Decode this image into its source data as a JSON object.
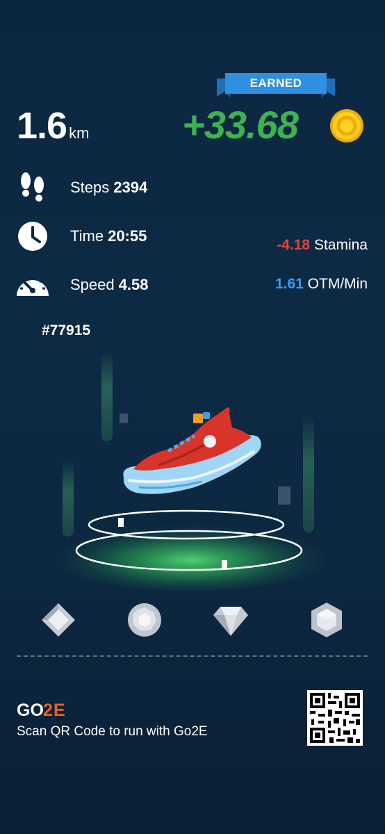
{
  "earned": {
    "badge_label": "EARNED",
    "amount": "+33.68",
    "coin_icon": "coin-icon"
  },
  "distance": {
    "value": "1.6",
    "unit": "km"
  },
  "stats": [
    {
      "icon": "footsteps-icon",
      "label": "Steps",
      "value": "2394"
    },
    {
      "icon": "clock-icon",
      "label": "Time",
      "value": "20:55"
    },
    {
      "icon": "speedometer-icon",
      "label": "Speed",
      "value": "4.58"
    }
  ],
  "stamina": {
    "value": "-4.18",
    "label": "Stamina"
  },
  "rate": {
    "value": "1.61",
    "label": "OTM/Min"
  },
  "shoe": {
    "id": "#77915",
    "image": "sneaker-icon"
  },
  "gem_slots": [
    "diamond-gem-icon",
    "round-gem-icon",
    "crystal-gem-icon",
    "hexagon-gem-icon"
  ],
  "footer": {
    "brand": "GO2E",
    "tagline": "Scan QR Code to run with Go2E",
    "qr_icon": "qr-code-icon"
  },
  "colors": {
    "earned_green": "#3fb24f",
    "stamina_red": "#e5433a",
    "rate_blue": "#3d9bf0",
    "ribbon_blue": "#2f8fe0",
    "brand_orange": "#f0621e",
    "background": "#0c2740"
  }
}
